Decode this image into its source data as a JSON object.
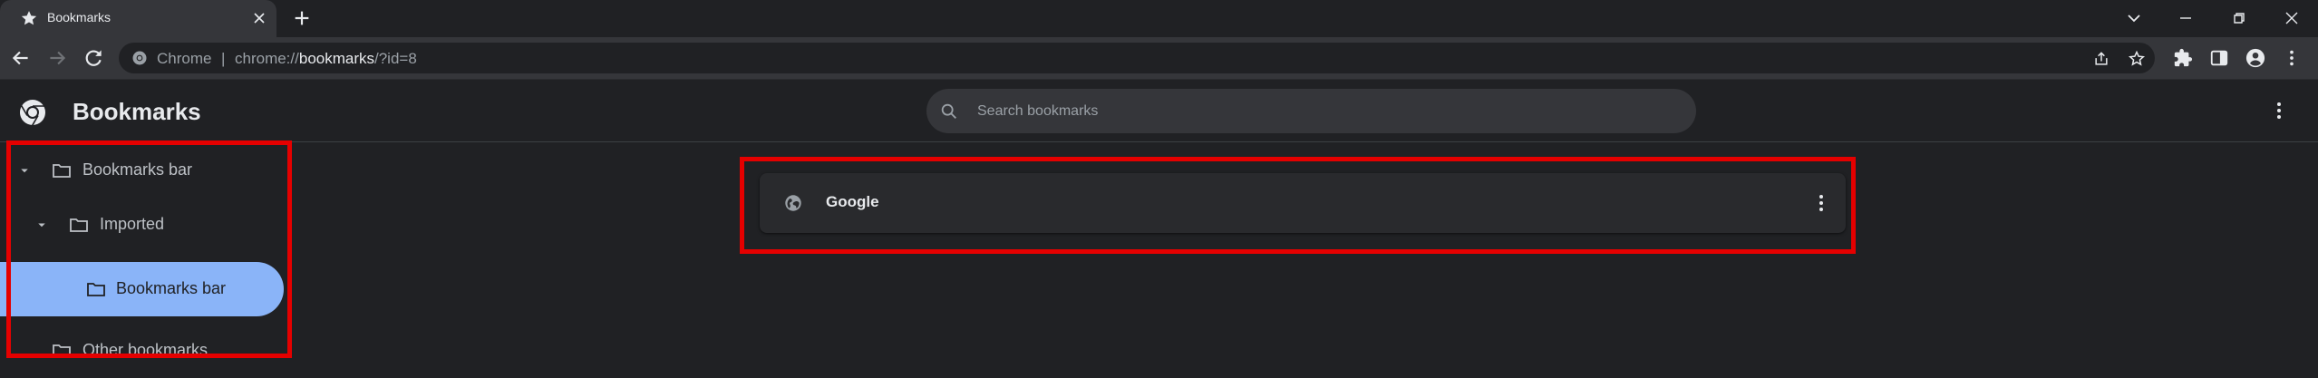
{
  "tab": {
    "title": "Bookmarks"
  },
  "omnibox": {
    "chip": "Chrome",
    "separator": "|",
    "url_prefix": "chrome://",
    "url_host": "bookmarks",
    "url_suffix": "/?id=8"
  },
  "header": {
    "title": "Bookmarks",
    "search_placeholder": "Search bookmarks"
  },
  "tree": [
    {
      "label": "Bookmarks bar",
      "expanded": true,
      "selected": false
    },
    {
      "label": "Imported",
      "expanded": true,
      "selected": false
    },
    {
      "label": "Bookmarks bar",
      "expanded": false,
      "selected": true
    },
    {
      "label": "Other bookmarks",
      "expanded": false,
      "selected": false
    }
  ],
  "bookmarks": [
    {
      "title": "Google",
      "icon": "globe-icon"
    }
  ],
  "highlight_color": "#e50000",
  "accent": "#8ab4f8"
}
